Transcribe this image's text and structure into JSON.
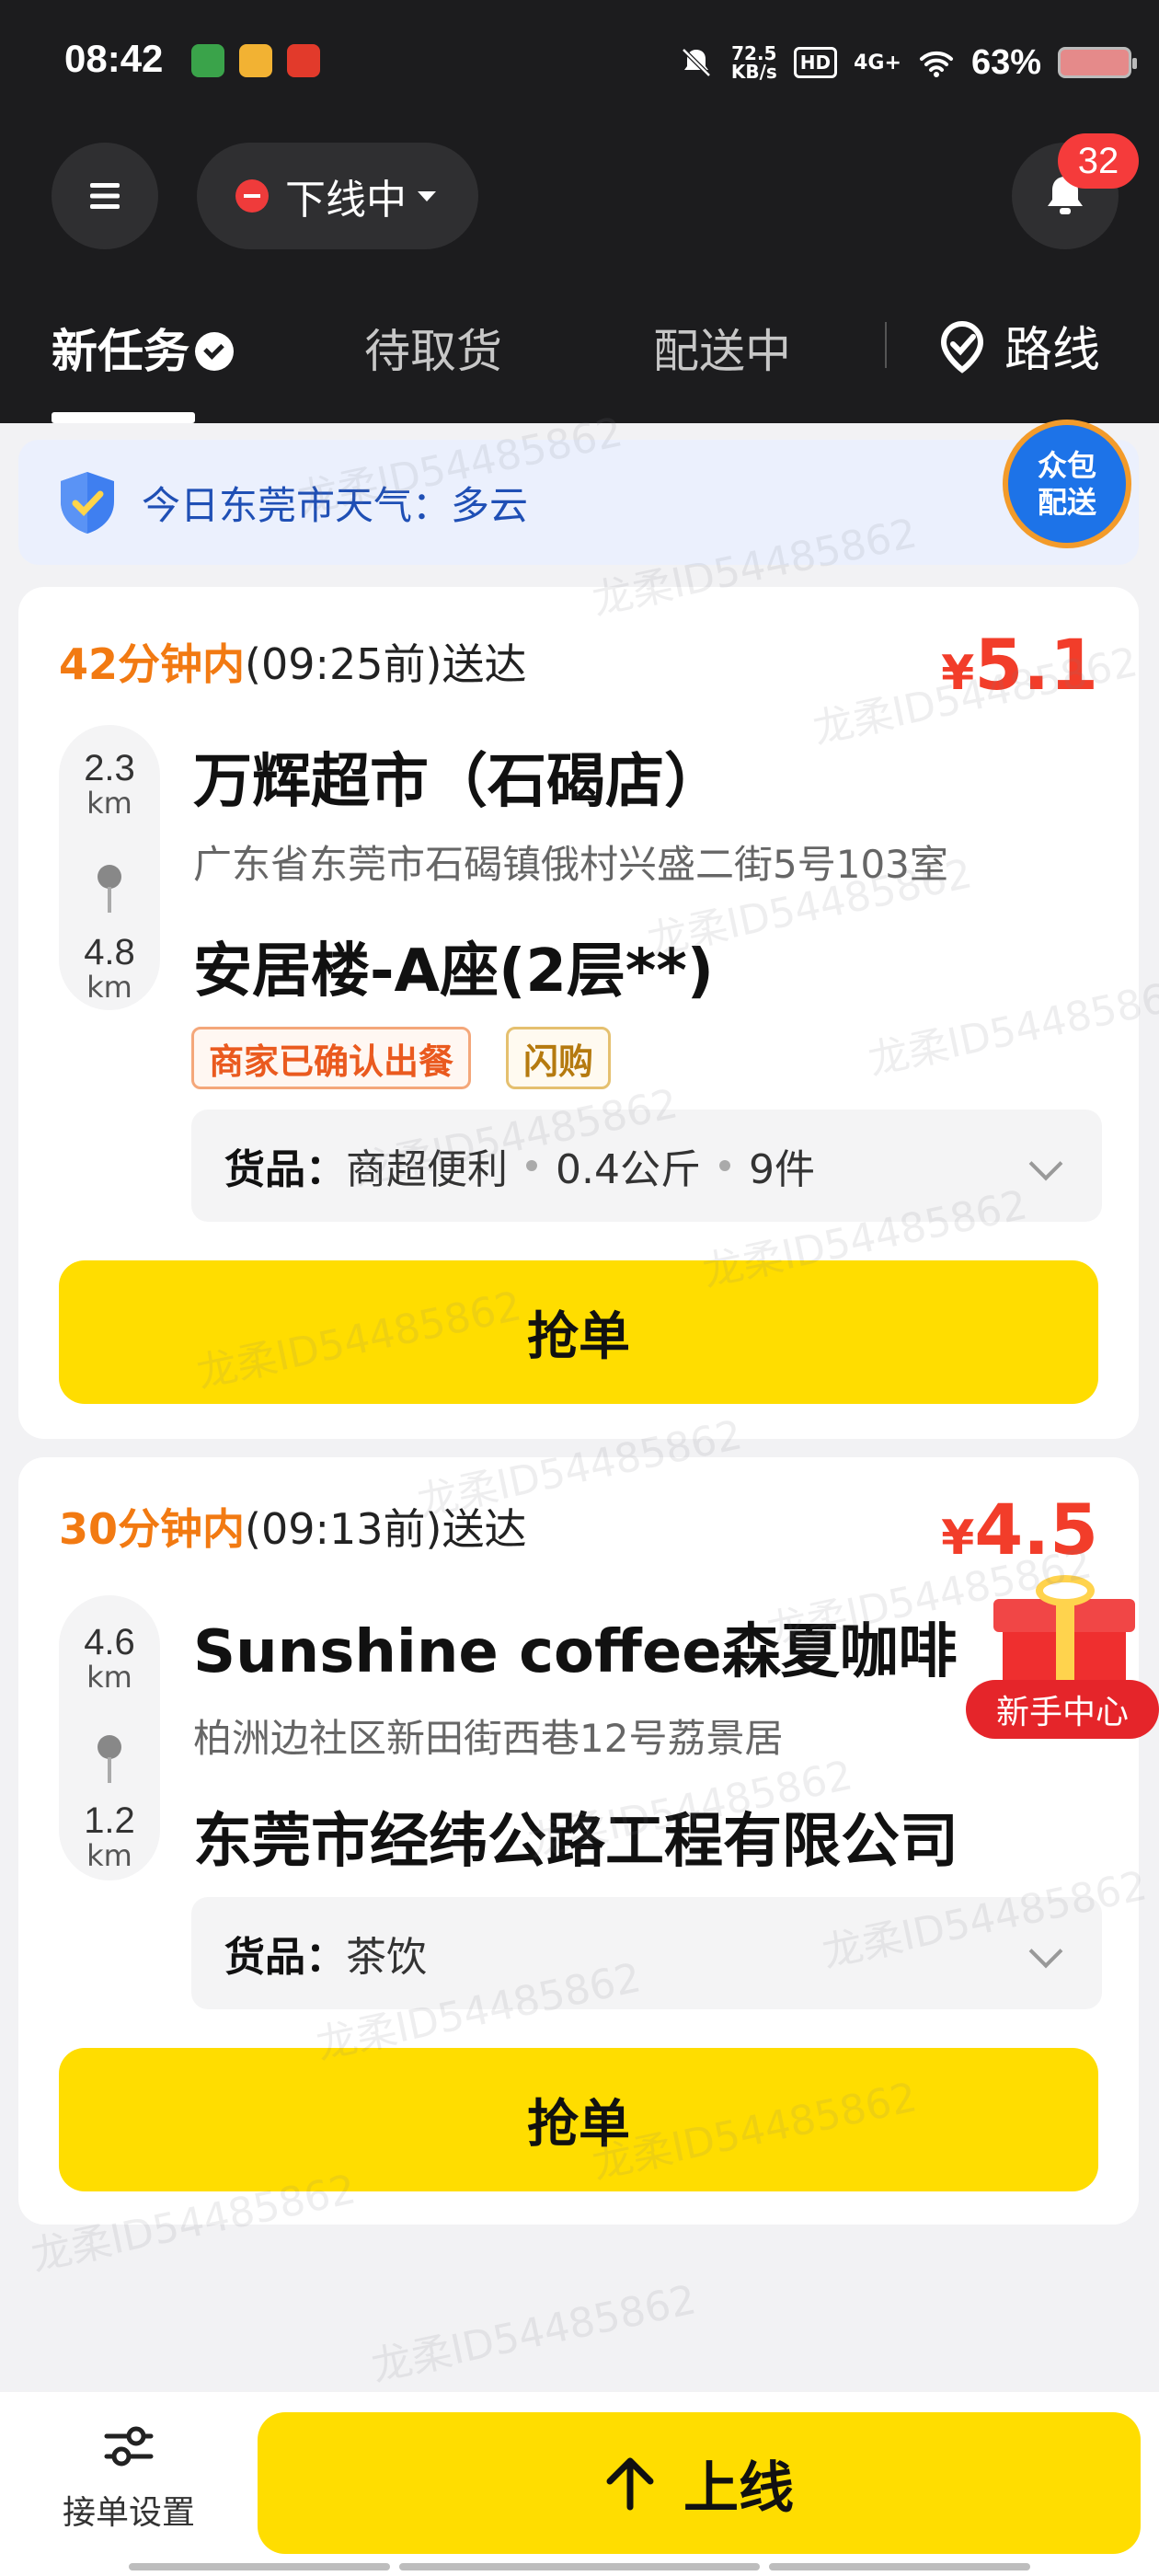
{
  "status_bar": {
    "time": "08:42",
    "net_speed_value": "72.5",
    "net_speed_unit": "KB/s",
    "hd": "HD",
    "signal": "4G+",
    "battery": "63%"
  },
  "header": {
    "status": "下线中",
    "notification_count": "32"
  },
  "tabs": {
    "new": "新任务",
    "pickup": "待取货",
    "delivering": "配送中",
    "route": "路线"
  },
  "weather": {
    "text": "今日东莞市天气：多云"
  },
  "crowd_badge": {
    "line1": "众包",
    "line2": "配送"
  },
  "orders": [
    {
      "deadline_mins": "42分钟内",
      "deadline_rest": "(09:25前)送达",
      "price_symbol": "¥",
      "price_value": "5.1",
      "pickup_distance": "2.3",
      "pickup_unit": "km",
      "dropoff_distance": "4.8",
      "dropoff_unit": "km",
      "shop_name": "万辉超市（石碣店）",
      "shop_address": "广东省东莞市石碣镇俄村兴盛二街5号103室",
      "destination": "安居楼-A座(2层**)",
      "tags": [
        "商家已确认出餐",
        "闪购"
      ],
      "goods_label": "货品：",
      "goods_category": "商超便利",
      "goods_weight": "0.4公斤",
      "goods_count": "9件",
      "grab_label": "抢单"
    },
    {
      "deadline_mins": "30分钟内",
      "deadline_rest": "(09:13前)送达",
      "price_symbol": "¥",
      "price_value": "4.5",
      "pickup_distance": "4.6",
      "pickup_unit": "km",
      "dropoff_distance": "1.2",
      "dropoff_unit": "km",
      "shop_name": "Sunshine coffee森夏咖啡",
      "shop_address": "柏洲边社区新田街西巷12号荔景居",
      "destination": "东莞市经纬公路工程有限公司",
      "goods_label": "货品：",
      "goods_category": "茶饮",
      "grab_label": "抢单"
    }
  ],
  "newbie": {
    "label": "新手中心"
  },
  "bottom": {
    "settings_label": "接单设置",
    "online_label": "上线"
  },
  "watermark": "龙柔ID54485862",
  "colors": {
    "header_bg": "#1c1c1e",
    "accent_yellow": "#ffdd00",
    "price_red": "#f23d2a",
    "deadline_orange": "#f27a12",
    "weather_blue": "#1f4fb5"
  }
}
